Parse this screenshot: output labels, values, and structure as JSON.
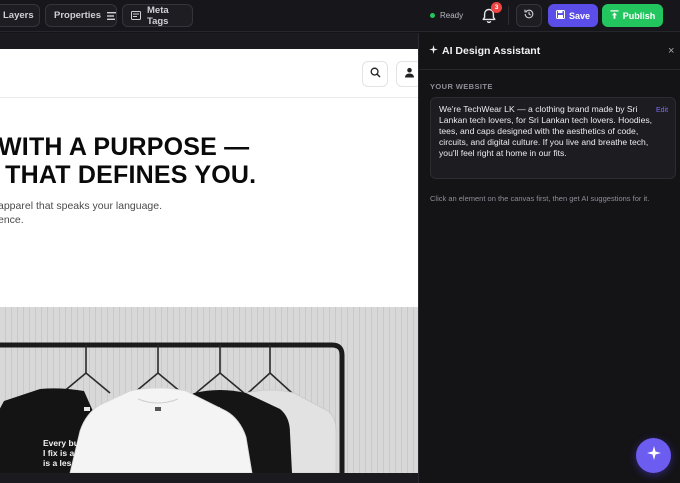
{
  "toolbar": {
    "layers_label": "Layers",
    "properties_label": "Properties",
    "meta_tags_label": "Meta Tags",
    "status_text": "Ready",
    "notification_count": "3",
    "save_label": "Save",
    "publish_label": "Publish"
  },
  "canvas": {
    "hero_title_line1": "WITH A PURPOSE —",
    "hero_title_line2": " THAT DEFINES YOU.",
    "hero_sub_line1": "apparel that speaks your language.",
    "hero_sub_line2": "ence.",
    "shirt_text_line1": "Every bu",
    "shirt_text_line2": "I fix is a",
    "shirt_text_line3": "is a les"
  },
  "panel": {
    "title": "AI Design Assistant",
    "close_glyph": "×",
    "section_label": "YOUR WEBSITE",
    "edit_label": "Edit",
    "website_description": "We're TechWear LK — a clothing brand made by Sri Lankan tech lovers, for Sri Lankan tech lovers. Hoodies, tees, and caps designed with the aesthetics of code, circuits, and digital culture. If you live and breathe tech, you'll feel right at home in our fits.",
    "hint": "Click an element on the canvas first, then get AI suggestions for it."
  },
  "icons": {
    "layers": "layers-icon",
    "properties": "properties-icon",
    "meta_tags": "meta-tags-icon",
    "bell": "bell-icon",
    "history": "history-icon",
    "save": "save-icon",
    "publish": "upload-icon",
    "sparkle": "sparkle-icon",
    "search": "search-icon",
    "user": "user-icon"
  },
  "colors": {
    "accent": "#5b4ee8",
    "publish": "#22c55e",
    "status_ready": "#22c55e",
    "badge": "#ef4444",
    "fab": "#6d5cf0"
  }
}
